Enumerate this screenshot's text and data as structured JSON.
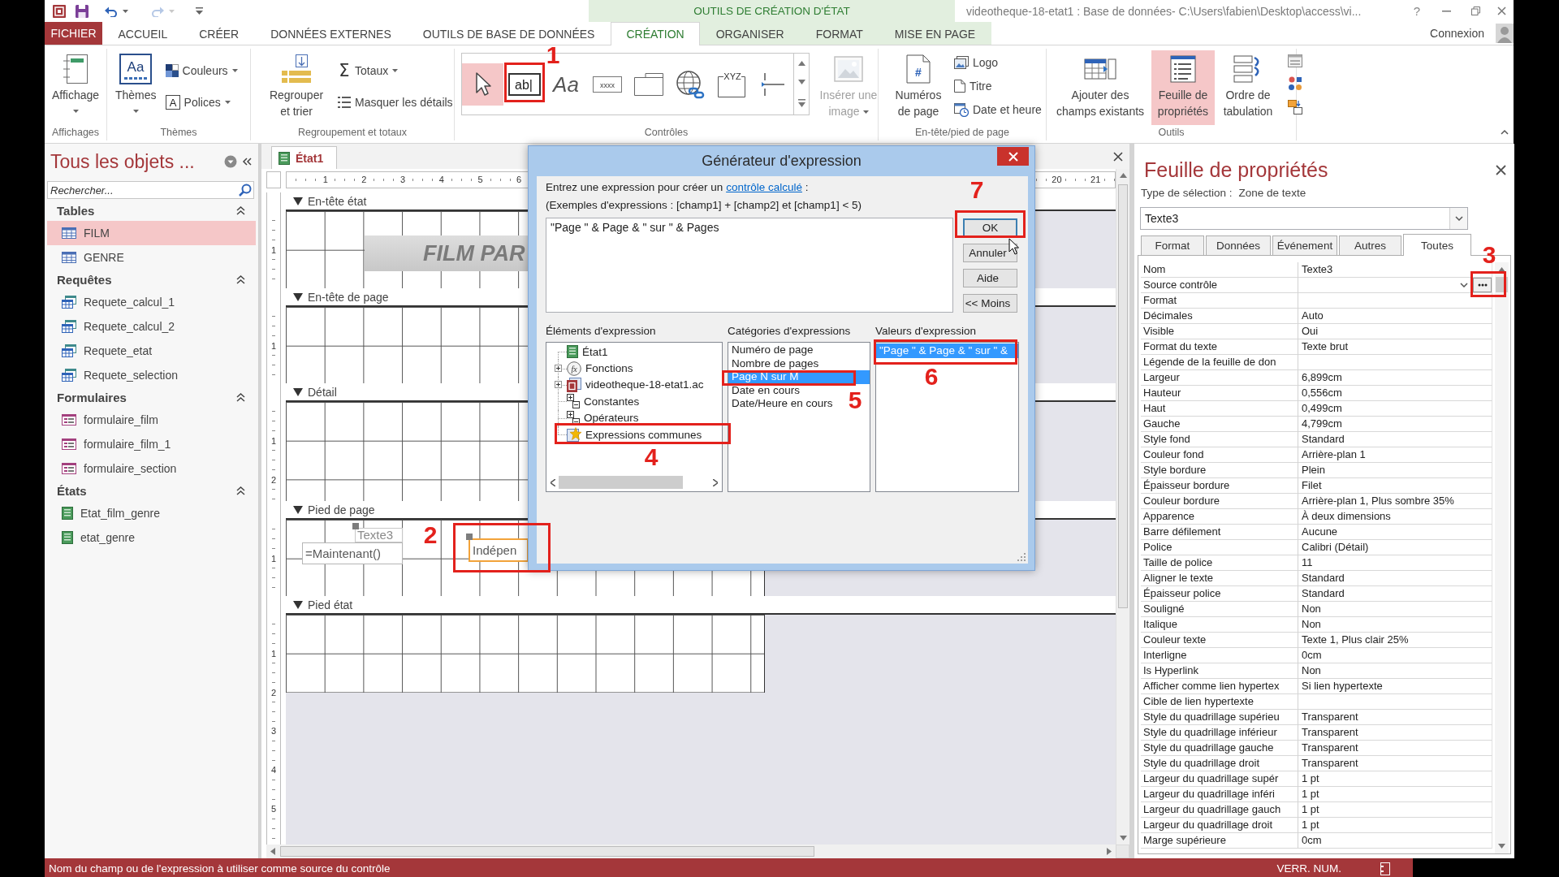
{
  "title_bar": {
    "context_label": "OUTILS DE CRÉATION D'ÉTAT",
    "title": "videotheque-18-etat1 : Base de données- C:\\Users\\fabien\\Desktop\\access\\vi...",
    "help": "?",
    "redo_disabled": true
  },
  "ribbon_tabs": [
    {
      "label": "FICHIER",
      "kind": "file",
      "selected": false
    },
    {
      "label": "ACCUEIL",
      "kind": "standard",
      "selected": false
    },
    {
      "label": "CRÉER",
      "kind": "standard",
      "selected": false
    },
    {
      "label": "DONNÉES EXTERNES",
      "kind": "standard",
      "selected": false
    },
    {
      "label": "OUTILS DE BASE DE DONNÉES",
      "kind": "standard",
      "selected": false
    },
    {
      "label": "CRÉATION",
      "kind": "contextual",
      "selected": true
    },
    {
      "label": "ORGANISER",
      "kind": "contextual",
      "selected": false
    },
    {
      "label": "FORMAT",
      "kind": "contextual",
      "selected": false
    },
    {
      "label": "MISE EN PAGE",
      "kind": "contextual",
      "selected": false
    }
  ],
  "account": {
    "label": "Connexion"
  },
  "ribbon": {
    "views": {
      "label": "Affichages",
      "view": {
        "label": "Affichage"
      }
    },
    "themes": {
      "label": "Thèmes",
      "themes": {
        "label": "Thèmes",
        "glyph": "Aa"
      },
      "colors": {
        "label": "Couleurs"
      },
      "fonts": {
        "label": "Polices",
        "glyph": "A"
      }
    },
    "grouping": {
      "label": "Regroupement et totaux",
      "group_sort": {
        "label": "Regrouper et trier"
      },
      "totals": {
        "label": "Totaux",
        "glyph": "Σ"
      },
      "hide_details": {
        "label": "Masquer les détails"
      }
    },
    "controls": {
      "label": "Contrôles",
      "gallery": [
        {
          "kind": "pointer",
          "selected": true
        },
        {
          "kind": "textbox",
          "glyph": "ab|",
          "selected": false
        },
        {
          "kind": "label",
          "glyph": "Aa",
          "selected": false
        },
        {
          "kind": "button",
          "glyph": "xxxx",
          "selected": false
        },
        {
          "kind": "tab",
          "selected": false
        },
        {
          "kind": "hyperlink",
          "selected": false
        },
        {
          "kind": "option_group",
          "glyph": "XYZ",
          "selected": false
        },
        {
          "kind": "page_break",
          "selected": false
        }
      ],
      "insert_image": {
        "label": "Insérer une image",
        "disabled": true
      }
    },
    "header_footer": {
      "label": "En-tête/pied de page",
      "page_numbers": {
        "label": "Numéros de page",
        "glyph": "#"
      },
      "logo": {
        "label": "Logo"
      },
      "title": {
        "label": "Titre"
      },
      "date_time": {
        "label": "Date et heure"
      }
    },
    "tools": {
      "label": "Outils",
      "add_fields": {
        "label": "Ajouter des champs existants",
        "selected": false
      },
      "property_sheet": {
        "label": "Feuille de propriétés",
        "selected": true
      },
      "tab_order": {
        "label": "Ordre de tabulation",
        "selected": false
      }
    }
  },
  "navigation_pane": {
    "title": "Tous les objets ...",
    "search": {
      "placeholder": "Rechercher..."
    },
    "groups": [
      {
        "label": "Tables",
        "kind": "table",
        "expanded": true,
        "items": [
          {
            "label": "FILM",
            "selected": true
          },
          {
            "label": "GENRE",
            "selected": false
          }
        ]
      },
      {
        "label": "Requêtes",
        "kind": "query",
        "expanded": true,
        "items": [
          {
            "label": "Requete_calcul_1",
            "selected": false
          },
          {
            "label": "Requete_calcul_2",
            "selected": false
          },
          {
            "label": "Requete_etat",
            "selected": false
          },
          {
            "label": "Requete_selection",
            "selected": false
          }
        ]
      },
      {
        "label": "Formulaires",
        "kind": "form",
        "expanded": true,
        "items": [
          {
            "label": "formulaire_film",
            "selected": false
          },
          {
            "label": "formulaire_film_1",
            "selected": false
          },
          {
            "label": "formulaire_section",
            "selected": false
          }
        ]
      },
      {
        "label": "États",
        "kind": "report",
        "expanded": true,
        "items": [
          {
            "label": "Etat_film_genre",
            "selected": false
          },
          {
            "label": "etat_genre",
            "selected": false
          }
        ]
      }
    ]
  },
  "document": {
    "tab": "État1",
    "ruler": {
      "left_labels": [
        "1",
        "2",
        "3",
        "4",
        "5",
        "6"
      ],
      "right_labels": [
        "20",
        "21"
      ]
    },
    "sections": [
      {
        "label": "En-tête état",
        "ruler_labels": [
          "1"
        ],
        "controls": [
          {
            "kind": "title",
            "text": "FILM PAR",
            "selected": false,
            "move_handle": false
          }
        ]
      },
      {
        "label": "En-tête de page",
        "ruler_labels": [
          "1"
        ]
      },
      {
        "label": "Détail",
        "ruler_labels": [
          "1",
          "2"
        ]
      },
      {
        "label": "Pied de page",
        "ruler_labels": [
          "1"
        ],
        "controls": [
          {
            "kind": "textbox",
            "text": "=Maintenant()",
            "selected": false,
            "move_handle": false
          },
          {
            "kind": "label",
            "text": "Texte3",
            "selected": false,
            "move_handle": true
          },
          {
            "kind": "textbox",
            "text": "Indépen",
            "selected": true,
            "move_handle": true
          }
        ]
      },
      {
        "label": "Pied état",
        "ruler_labels": [
          "1",
          "2",
          "3",
          "4",
          "5"
        ]
      }
    ]
  },
  "dialog": {
    "title": "Générateur d'expression",
    "prompt": "Entrez une expression pour créer un",
    "prompt_link": "contrôle calculé",
    "prompt_end": ":",
    "example": "(Exemples d'expressions : [champ1] + [champ2] et [champ1] < 5)",
    "expression": "\"Page \" & Page & \" sur \" & Pages",
    "buttons": [
      {
        "label": "OK",
        "kind": "default"
      },
      {
        "label": "Annuler",
        "kind": "normal"
      },
      {
        "label": "Aide",
        "kind": "normal"
      },
      {
        "label": "<< Moins",
        "kind": "normal"
      }
    ],
    "elements": {
      "label": "Éléments d'expression",
      "items": [
        {
          "label": "État1",
          "kind": "report"
        },
        {
          "label": "Fonctions",
          "kind": "functions",
          "glyph": "fx",
          "expanded": false
        },
        {
          "label": "videotheque-18-etat1.ac",
          "kind": "database",
          "expanded": false
        },
        {
          "label": "Constantes",
          "kind": "constants"
        },
        {
          "label": "Opérateurs",
          "kind": "operators"
        },
        {
          "label": "Expressions communes",
          "kind": "common"
        }
      ]
    },
    "categories": {
      "label": "Catégories d'expressions",
      "items": [
        {
          "label": "Numéro de page",
          "selected": false
        },
        {
          "label": "Nombre de pages",
          "selected": false
        },
        {
          "label": "Page N sur M",
          "selected": true
        },
        {
          "label": "Date en cours",
          "selected": false
        },
        {
          "label": "Date/Heure en cours",
          "selected": false
        }
      ]
    },
    "values": {
      "label": "Valeurs d'expression",
      "items": [
        {
          "label": "\"Page \" & Page & \" sur \" &",
          "selected": true
        }
      ]
    }
  },
  "property_sheet": {
    "title": "Feuille de propriétés",
    "selection_label": "Type de sélection :",
    "selection_type": "Zone de texte",
    "object": "Texte3",
    "tabs": [
      {
        "label": "Format",
        "selected": false
      },
      {
        "label": "Données",
        "selected": false
      },
      {
        "label": "Événement",
        "selected": false
      },
      {
        "label": "Autres",
        "selected": false
      },
      {
        "label": "Toutes",
        "selected": true
      }
    ],
    "rows": [
      {
        "name": "Nom",
        "value": "Texte3",
        "kind": "text"
      },
      {
        "name": "Source contrôle",
        "kind": "builder"
      },
      {
        "name": "Format",
        "kind": "text"
      },
      {
        "name": "Décimales",
        "value": "Auto",
        "kind": "text"
      },
      {
        "name": "Visible",
        "value": "Oui",
        "kind": "text"
      },
      {
        "name": "Format du texte",
        "value": "Texte brut",
        "kind": "text"
      },
      {
        "name": "Légende de la feuille de don",
        "kind": "text"
      },
      {
        "name": "Largeur",
        "value": "6,899cm",
        "kind": "text"
      },
      {
        "name": "Hauteur",
        "value": "0,556cm",
        "kind": "text"
      },
      {
        "name": "Haut",
        "value": "0,499cm",
        "kind": "text"
      },
      {
        "name": "Gauche",
        "value": "4,799cm",
        "kind": "text"
      },
      {
        "name": "Style fond",
        "value": "Standard",
        "kind": "text"
      },
      {
        "name": "Couleur fond",
        "value": "Arrière-plan 1",
        "kind": "text"
      },
      {
        "name": "Style bordure",
        "value": "Plein",
        "kind": "text"
      },
      {
        "name": "Épaisseur bordure",
        "value": "Filet",
        "kind": "text"
      },
      {
        "name": "Couleur bordure",
        "value": "Arrière-plan 1, Plus sombre 35%",
        "kind": "text"
      },
      {
        "name": "Apparence",
        "value": "À deux dimensions",
        "kind": "text"
      },
      {
        "name": "Barre défilement",
        "value": "Aucune",
        "kind": "text"
      },
      {
        "name": "Police",
        "value": "Calibri (Détail)",
        "kind": "text"
      },
      {
        "name": "Taille de police",
        "value": "11",
        "kind": "text"
      },
      {
        "name": "Aligner le texte",
        "value": "Standard",
        "kind": "text"
      },
      {
        "name": "Épaisseur police",
        "value": "Standard",
        "kind": "text"
      },
      {
        "name": "Souligné",
        "value": "Non",
        "kind": "text"
      },
      {
        "name": "Italique",
        "value": "Non",
        "kind": "text"
      },
      {
        "name": "Couleur texte",
        "value": "Texte 1, Plus clair 25%",
        "kind": "text"
      },
      {
        "name": "Interligne",
        "value": "0cm",
        "kind": "text"
      },
      {
        "name": "Is Hyperlink",
        "value": "Non",
        "kind": "text"
      },
      {
        "name": "Afficher comme lien hypertex",
        "value": "Si lien hypertexte",
        "kind": "text"
      },
      {
        "name": "Cible de lien hypertexte",
        "kind": "text"
      },
      {
        "name": "Style du quadrillage supérieu",
        "value": "Transparent",
        "kind": "text"
      },
      {
        "name": "Style du quadrillage inférieur",
        "value": "Transparent",
        "kind": "text"
      },
      {
        "name": "Style du quadrillage gauche",
        "value": "Transparent",
        "kind": "text"
      },
      {
        "name": "Style du quadrillage droit",
        "value": "Transparent",
        "kind": "text"
      },
      {
        "name": "Largeur du quadrillage supér",
        "value": "1 pt",
        "kind": "text"
      },
      {
        "name": "Largeur du quadrillage inféri",
        "value": "1 pt",
        "kind": "text"
      },
      {
        "name": "Largeur du quadrillage gauch",
        "value": "1 pt",
        "kind": "text"
      },
      {
        "name": "Largeur du quadrillage droit",
        "value": "1 pt",
        "kind": "text"
      },
      {
        "name": "Marge supérieure",
        "value": "0cm",
        "kind": "text"
      }
    ]
  },
  "status_bar": {
    "message": "Nom du champ ou de l'expression à utiliser comme source du contrôle",
    "indicator": "VERR. NUM."
  },
  "callouts": [
    {
      "label": "1"
    },
    {
      "label": "2"
    },
    {
      "label": "3"
    },
    {
      "label": "4"
    },
    {
      "label": "5"
    },
    {
      "label": "6"
    },
    {
      "label": "7"
    }
  ]
}
